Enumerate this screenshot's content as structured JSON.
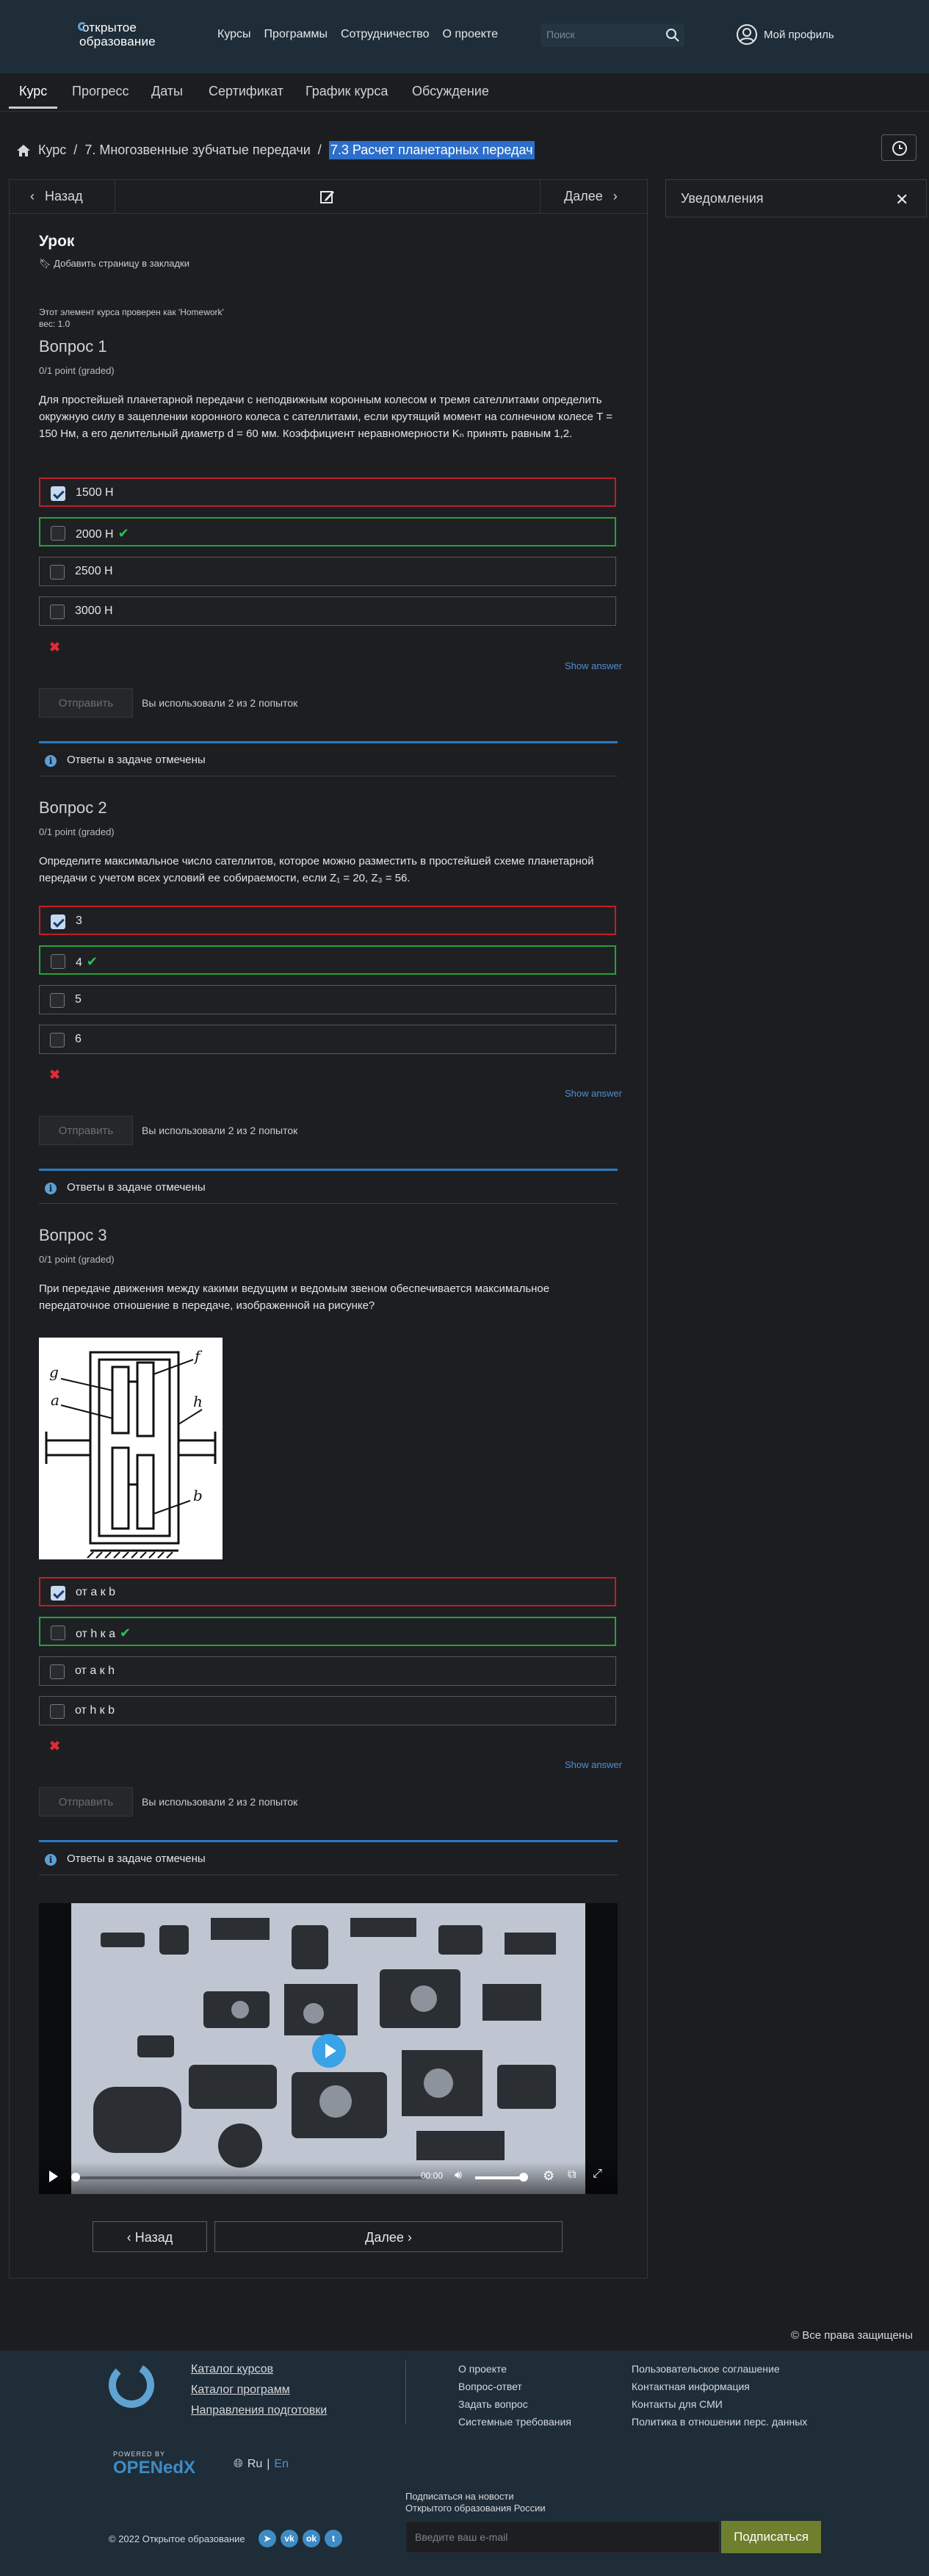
{
  "header": {
    "logo_line1": "открытое",
    "logo_line2": "образование",
    "nav": [
      "Курсы",
      "Программы",
      "Сотрудничество",
      "О проекте"
    ],
    "search_placeholder": "Поиск",
    "profile_label": "Мой профиль"
  },
  "course_tabs": [
    "Курс",
    "Прогресс",
    "Даты",
    "Сертификат",
    "График курса",
    "Обсуждение"
  ],
  "breadcrumb": {
    "home": "Курс",
    "section": "7. Многозвенные зубчатые передачи",
    "current": "7.3 Расчет планетарных передач"
  },
  "notifications": {
    "label": "Уведомления"
  },
  "seq_nav": {
    "prev": "Назад",
    "next": "Далее"
  },
  "lesson": {
    "title": "Урок",
    "bookmark": "Добавить страницу в закладки",
    "graded_note": "Этот элемент курса проверен как 'Homework'",
    "weight": "вес: 1.0"
  },
  "questions": [
    {
      "title": "Вопрос 1",
      "points": "0/1 point (graded)",
      "text": "Для простейшей планетарной передачи с неподвижным коронным колесом и тремя сателлитами определить окружную силу в зацеплении коронного колеса с сателлитами, если крутящий момент на солнечном колесе T = 150 Нм, а его делительный диаметр d = 60 мм. Коэффициент неравномерности Kₙ принять равным 1,2.",
      "options": [
        "1500 Н",
        "2000 Н",
        "2500 Н",
        "3000 Н"
      ],
      "show_answer": "Show answer",
      "submit": "Отправить",
      "attempts": "Вы использовали 2 из 2 попыток",
      "notice": "Ответы в задаче отмечены"
    },
    {
      "title": "Вопрос 2",
      "points": "0/1 point (graded)",
      "text": "Определите максимальное число сателлитов, которое можно разместить в простейшей схеме планетарной передачи с учетом всех условий ее собираемости, если Z₁ = 20, Z₃ = 56.",
      "options": [
        "3",
        "4",
        "5",
        "6"
      ],
      "show_answer": "Show answer",
      "submit": "Отправить",
      "attempts": "Вы использовали 2 из 2 попыток",
      "notice": "Ответы в задаче отмечены"
    },
    {
      "title": "Вопрос 3",
      "points": "0/1 point (graded)",
      "text": "При передаче движения между какими ведущим и ведомым звеном обеспечивается максимальное передаточное отношение в передаче, изображенной на рисунке?",
      "diagram_labels": [
        "g",
        "f",
        "a",
        "h",
        "b"
      ],
      "options": [
        "от a к b",
        "от h к a",
        "от a к h",
        "от h к b"
      ],
      "show_answer": "Show answer",
      "submit": "Отправить",
      "attempts": "Вы использовали 2 из 2 попыток",
      "notice": "Ответы в задаче отмечены"
    }
  ],
  "video": {
    "time": "00:00"
  },
  "bottom_nav": {
    "prev": "Назад",
    "next": "Далее"
  },
  "copyright": "© Все права защищены",
  "footer": {
    "main_links": [
      "Каталог курсов",
      "Каталог программ",
      "Направления подготовки"
    ],
    "col2": [
      "О проекте",
      "Вопрос-ответ",
      "Задать вопрос",
      "Системные требования"
    ],
    "col3": [
      "Пользовательское соглашение",
      "Контактная информация",
      "Контакты для СМИ",
      "Политика в отношении перс. данных"
    ],
    "powered": "POWERED BY",
    "openedx": "OPENedX",
    "lang_ru": "Ru",
    "lang_sep": "|",
    "lang_en": "En",
    "subscribe_title": "Подписаться на новости",
    "subscribe_sub": "Открытого образования России",
    "email_placeholder": "Введите ваш e-mail",
    "subscribe_btn": "Подписаться",
    "copy": "© 2022 Открытое образование",
    "social": [
      "tg",
      "vk",
      "ok",
      "tw"
    ]
  }
}
